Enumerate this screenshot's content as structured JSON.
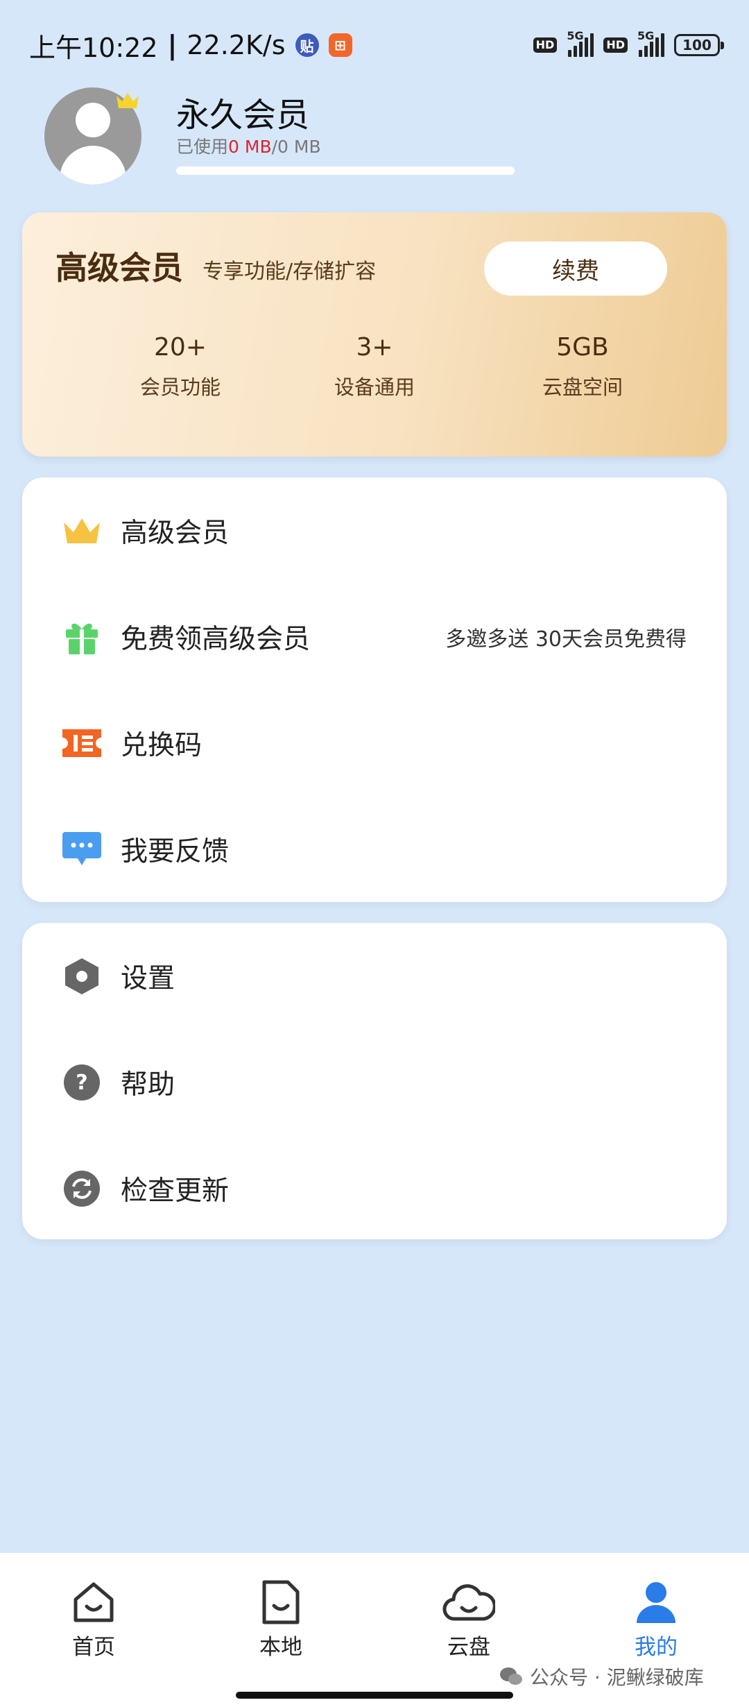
{
  "status_bar": {
    "time": "上午10:22",
    "speed": "22.2K/s",
    "network": "5G",
    "hd": "HD",
    "battery": "100",
    "app1_glyph": "贴",
    "app2_glyph": "⊞"
  },
  "profile": {
    "name": "永久会员",
    "storage_prefix": "已使用",
    "storage_used": "0 MB",
    "storage_total": "/0 MB",
    "storage_fraction": 0
  },
  "premium": {
    "title": "高级会员",
    "subtitle": "专享功能/存储扩容",
    "renew_label": "续费",
    "stats": [
      {
        "value": "20+",
        "label": "会员功能"
      },
      {
        "value": "3+",
        "label": "设备通用"
      },
      {
        "value": "5GB",
        "label": "云盘空间"
      }
    ]
  },
  "menu1": [
    {
      "label": "高级会员",
      "icon": "crown-icon",
      "hint": ""
    },
    {
      "label": "免费领高级会员",
      "icon": "gift-icon",
      "hint": "多邀多送 30天会员免费得"
    },
    {
      "label": "兑换码",
      "icon": "ticket-icon",
      "hint": ""
    },
    {
      "label": "我要反馈",
      "icon": "chat-bubble-icon",
      "hint": ""
    }
  ],
  "menu2": [
    {
      "label": "设置",
      "icon": "gear-hexagon-icon"
    },
    {
      "label": "帮助",
      "icon": "help-icon"
    },
    {
      "label": "检查更新",
      "icon": "refresh-icon"
    }
  ],
  "bottom_nav": [
    {
      "label": "首页",
      "icon": "home-icon"
    },
    {
      "label": "本地",
      "icon": "file-icon"
    },
    {
      "label": "云盘",
      "icon": "cloud-icon"
    },
    {
      "label": "我的",
      "icon": "person-icon",
      "active": true
    }
  ],
  "watermark": "公众号 · 泥鳅绿破库",
  "colors": {
    "background": "#d7e7fa",
    "accent": "#2a7ce8",
    "crown": "#f5c242",
    "gift": "#5bd36a",
    "ticket": "#f26522",
    "chat": "#4a9ef0",
    "storage_used": "#d6262e"
  }
}
